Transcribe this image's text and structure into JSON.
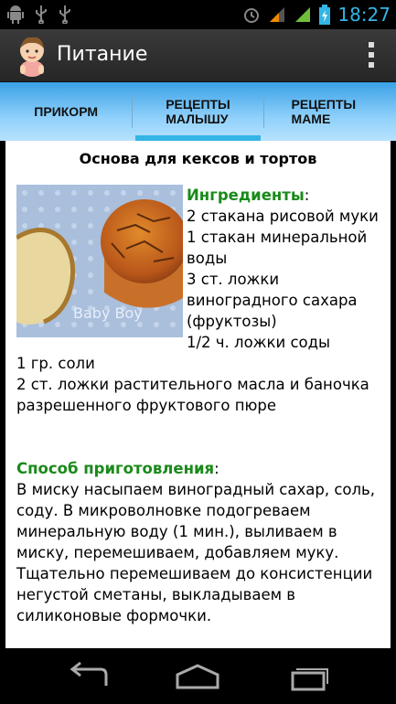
{
  "status_bar": {
    "time": "18:27",
    "left_icons": [
      "android-icon",
      "usb-icon",
      "usb-icon"
    ],
    "right_icons": [
      "alarm-icon",
      "signal-icon",
      "signal-icon",
      "battery-icon"
    ],
    "accent_color": "#33b5e5"
  },
  "action_bar": {
    "title": "Питание",
    "icon": "baby-avatar-icon",
    "menu_icon": "overflow-menu-icon"
  },
  "tabs": [
    {
      "line1": "ПРИКОРМ",
      "line2": "",
      "active": false
    },
    {
      "line1": "РЕЦЕПТЫ",
      "line2": "МАЛЫШУ",
      "active": true
    },
    {
      "line1": "РЕЦЕПТЫ",
      "line2": "МАМЕ",
      "active": false
    }
  ],
  "recipe": {
    "title": "Основа для кексов и тортов",
    "ingredients_heading": "Ингредиенты",
    "ingredients_colon": ":",
    "ingredients": [
      "2 стакана рисовой муки",
      "1 стакан минеральной воды",
      "3 ст. ложки виноградного сахара (фруктозы)",
      "1/2 ч. ложки соды",
      "1 гр. соли",
      "2 ст. ложки растительного масла и баночка разрешенного фруктового пюре"
    ],
    "method_heading": "Способ приготовления",
    "method_colon": ":",
    "method_text": "В миску насыпаем виноградный сахар, соль, соду. В микроволновке подогреваем минеральную воду (1 мин.), выливаем в миску, перемешиваем, добавляем муку. Тщательно перемешиваем до консистенции негустой сметаны, выкладываем в силиконовые формочки.",
    "photo_caption": "Baby Boy"
  },
  "nav_bar": {
    "back": "back-icon",
    "home": "home-icon",
    "recents": "recent-apps-icon"
  }
}
